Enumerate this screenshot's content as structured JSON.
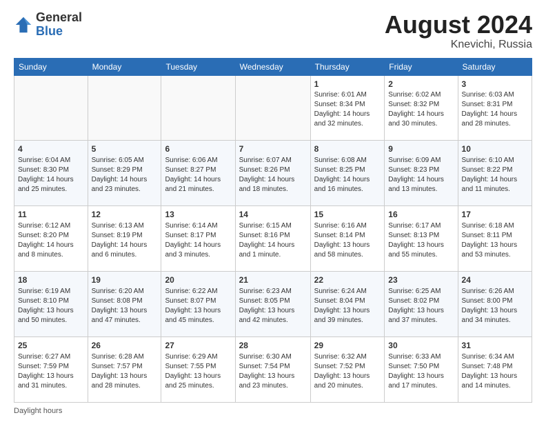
{
  "logo": {
    "general": "General",
    "blue": "Blue"
  },
  "header": {
    "month_year": "August 2024",
    "location": "Knevichi, Russia"
  },
  "days_of_week": [
    "Sunday",
    "Monday",
    "Tuesday",
    "Wednesday",
    "Thursday",
    "Friday",
    "Saturday"
  ],
  "footer": {
    "label": "Daylight hours"
  },
  "weeks": [
    [
      {
        "day": "",
        "content": ""
      },
      {
        "day": "",
        "content": ""
      },
      {
        "day": "",
        "content": ""
      },
      {
        "day": "",
        "content": ""
      },
      {
        "day": "1",
        "content": "Sunrise: 6:01 AM\nSunset: 8:34 PM\nDaylight: 14 hours and 32 minutes."
      },
      {
        "day": "2",
        "content": "Sunrise: 6:02 AM\nSunset: 8:32 PM\nDaylight: 14 hours and 30 minutes."
      },
      {
        "day": "3",
        "content": "Sunrise: 6:03 AM\nSunset: 8:31 PM\nDaylight: 14 hours and 28 minutes."
      }
    ],
    [
      {
        "day": "4",
        "content": "Sunrise: 6:04 AM\nSunset: 8:30 PM\nDaylight: 14 hours and 25 minutes."
      },
      {
        "day": "5",
        "content": "Sunrise: 6:05 AM\nSunset: 8:29 PM\nDaylight: 14 hours and 23 minutes."
      },
      {
        "day": "6",
        "content": "Sunrise: 6:06 AM\nSunset: 8:27 PM\nDaylight: 14 hours and 21 minutes."
      },
      {
        "day": "7",
        "content": "Sunrise: 6:07 AM\nSunset: 8:26 PM\nDaylight: 14 hours and 18 minutes."
      },
      {
        "day": "8",
        "content": "Sunrise: 6:08 AM\nSunset: 8:25 PM\nDaylight: 14 hours and 16 minutes."
      },
      {
        "day": "9",
        "content": "Sunrise: 6:09 AM\nSunset: 8:23 PM\nDaylight: 14 hours and 13 minutes."
      },
      {
        "day": "10",
        "content": "Sunrise: 6:10 AM\nSunset: 8:22 PM\nDaylight: 14 hours and 11 minutes."
      }
    ],
    [
      {
        "day": "11",
        "content": "Sunrise: 6:12 AM\nSunset: 8:20 PM\nDaylight: 14 hours and 8 minutes."
      },
      {
        "day": "12",
        "content": "Sunrise: 6:13 AM\nSunset: 8:19 PM\nDaylight: 14 hours and 6 minutes."
      },
      {
        "day": "13",
        "content": "Sunrise: 6:14 AM\nSunset: 8:17 PM\nDaylight: 14 hours and 3 minutes."
      },
      {
        "day": "14",
        "content": "Sunrise: 6:15 AM\nSunset: 8:16 PM\nDaylight: 14 hours and 1 minute."
      },
      {
        "day": "15",
        "content": "Sunrise: 6:16 AM\nSunset: 8:14 PM\nDaylight: 13 hours and 58 minutes."
      },
      {
        "day": "16",
        "content": "Sunrise: 6:17 AM\nSunset: 8:13 PM\nDaylight: 13 hours and 55 minutes."
      },
      {
        "day": "17",
        "content": "Sunrise: 6:18 AM\nSunset: 8:11 PM\nDaylight: 13 hours and 53 minutes."
      }
    ],
    [
      {
        "day": "18",
        "content": "Sunrise: 6:19 AM\nSunset: 8:10 PM\nDaylight: 13 hours and 50 minutes."
      },
      {
        "day": "19",
        "content": "Sunrise: 6:20 AM\nSunset: 8:08 PM\nDaylight: 13 hours and 47 minutes."
      },
      {
        "day": "20",
        "content": "Sunrise: 6:22 AM\nSunset: 8:07 PM\nDaylight: 13 hours and 45 minutes."
      },
      {
        "day": "21",
        "content": "Sunrise: 6:23 AM\nSunset: 8:05 PM\nDaylight: 13 hours and 42 minutes."
      },
      {
        "day": "22",
        "content": "Sunrise: 6:24 AM\nSunset: 8:04 PM\nDaylight: 13 hours and 39 minutes."
      },
      {
        "day": "23",
        "content": "Sunrise: 6:25 AM\nSunset: 8:02 PM\nDaylight: 13 hours and 37 minutes."
      },
      {
        "day": "24",
        "content": "Sunrise: 6:26 AM\nSunset: 8:00 PM\nDaylight: 13 hours and 34 minutes."
      }
    ],
    [
      {
        "day": "25",
        "content": "Sunrise: 6:27 AM\nSunset: 7:59 PM\nDaylight: 13 hours and 31 minutes."
      },
      {
        "day": "26",
        "content": "Sunrise: 6:28 AM\nSunset: 7:57 PM\nDaylight: 13 hours and 28 minutes."
      },
      {
        "day": "27",
        "content": "Sunrise: 6:29 AM\nSunset: 7:55 PM\nDaylight: 13 hours and 25 minutes."
      },
      {
        "day": "28",
        "content": "Sunrise: 6:30 AM\nSunset: 7:54 PM\nDaylight: 13 hours and 23 minutes."
      },
      {
        "day": "29",
        "content": "Sunrise: 6:32 AM\nSunset: 7:52 PM\nDaylight: 13 hours and 20 minutes."
      },
      {
        "day": "30",
        "content": "Sunrise: 6:33 AM\nSunset: 7:50 PM\nDaylight: 13 hours and 17 minutes."
      },
      {
        "day": "31",
        "content": "Sunrise: 6:34 AM\nSunset: 7:48 PM\nDaylight: 13 hours and 14 minutes."
      }
    ]
  ]
}
